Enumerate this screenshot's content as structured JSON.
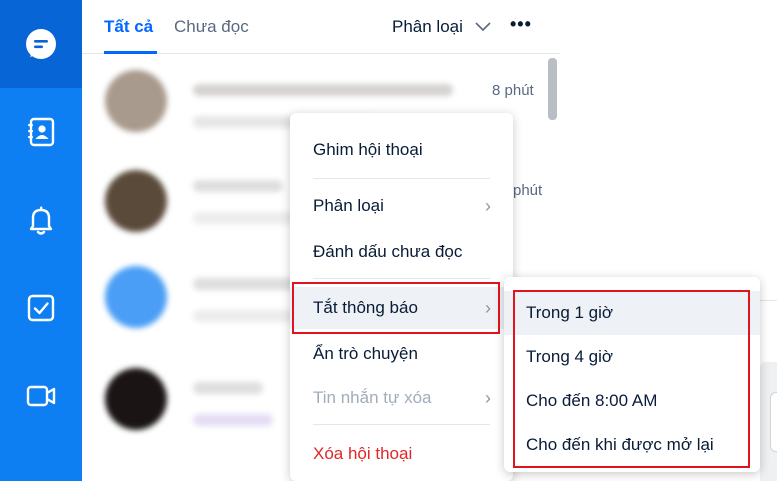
{
  "nav": {
    "items": [
      {
        "icon": "chat-icon",
        "active": true
      },
      {
        "icon": "contacts-icon",
        "active": false
      },
      {
        "icon": "bell-icon",
        "active": false
      },
      {
        "icon": "todo-checkbox-icon",
        "active": false
      },
      {
        "icon": "video-call-icon",
        "active": false
      }
    ]
  },
  "tabs": {
    "all": "Tất cả",
    "unread": "Chưa đọc",
    "filter": "Phân loại",
    "more": "•••"
  },
  "conversations": {
    "times": [
      "8 phút",
      "phút"
    ]
  },
  "context_menu": {
    "pin": "Ghim hội thoại",
    "classify": "Phân loại",
    "mark_unread": "Đánh dấu chưa đọc",
    "mute": "Tắt thông báo",
    "hide": "Ẩn trò chuyện",
    "auto_delete": "Tin nhắn tự xóa",
    "delete": "Xóa hội thoại",
    "chevron": "›"
  },
  "mute_submenu": {
    "options": [
      "Trong 1 giờ",
      "Trong 4 giờ",
      "Cho đến 8:00 AM",
      "Cho đến khi được mở lại"
    ]
  },
  "colors": {
    "nav_bg": "#0d7ff2",
    "nav_active": "#0865d6",
    "accent": "#0068ff",
    "danger": "#e02727",
    "highlight": "#e0141e"
  }
}
